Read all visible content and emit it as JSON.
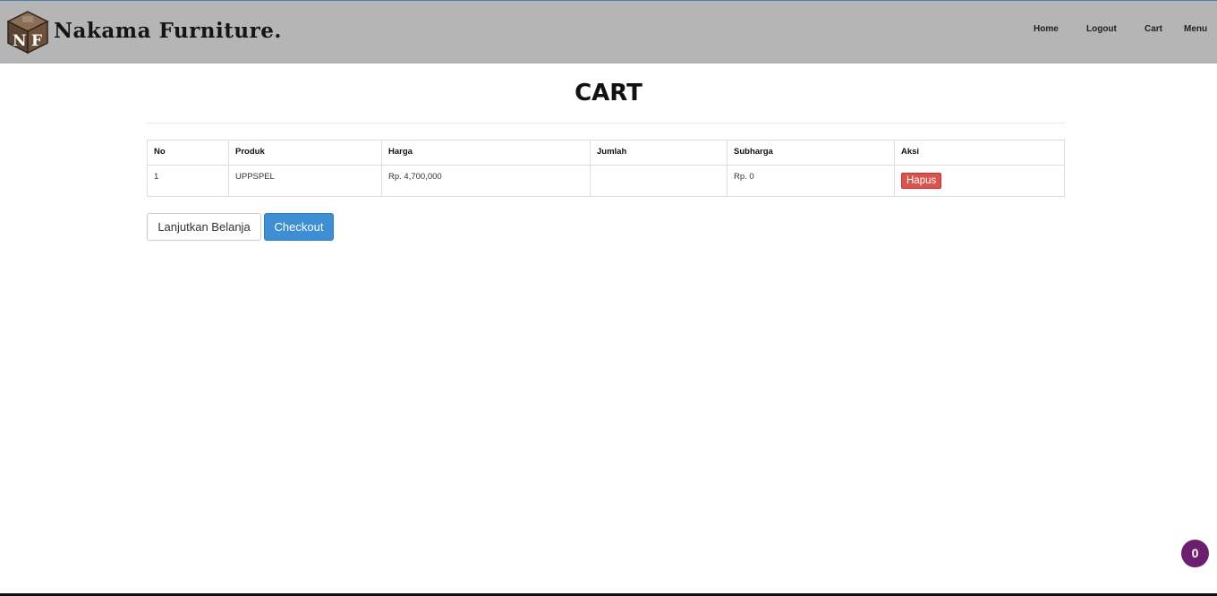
{
  "header": {
    "brand_initials": "NF",
    "brand_name": "Nakama Furniture.",
    "nav": [
      {
        "label": "Home"
      },
      {
        "label": "Logout"
      },
      {
        "label": "Cart"
      },
      {
        "label": "Menu"
      }
    ]
  },
  "page": {
    "title": "CART"
  },
  "cart_table": {
    "columns": [
      "No",
      "Produk",
      "Harga",
      "Jumlah",
      "Subharga",
      "Aksi"
    ],
    "rows": [
      {
        "no": "1",
        "produk": "UPPSPEL",
        "harga": "Rp. 4,700,000",
        "jumlah": "",
        "subharga": "Rp. 0",
        "aksi": "Hapus"
      }
    ]
  },
  "actions": {
    "continue_label": "Lanjutkan Belanja",
    "checkout_label": "Checkout"
  },
  "cart_badge": {
    "count": "0"
  },
  "colors": {
    "navbar_bg": "#b5b5b5",
    "checkout_blue": "#3d8ed2",
    "delete_red": "#d9534f",
    "badge_purple": "#6b1f6e"
  },
  "icons": {
    "logo": "nf-cube-logo"
  }
}
